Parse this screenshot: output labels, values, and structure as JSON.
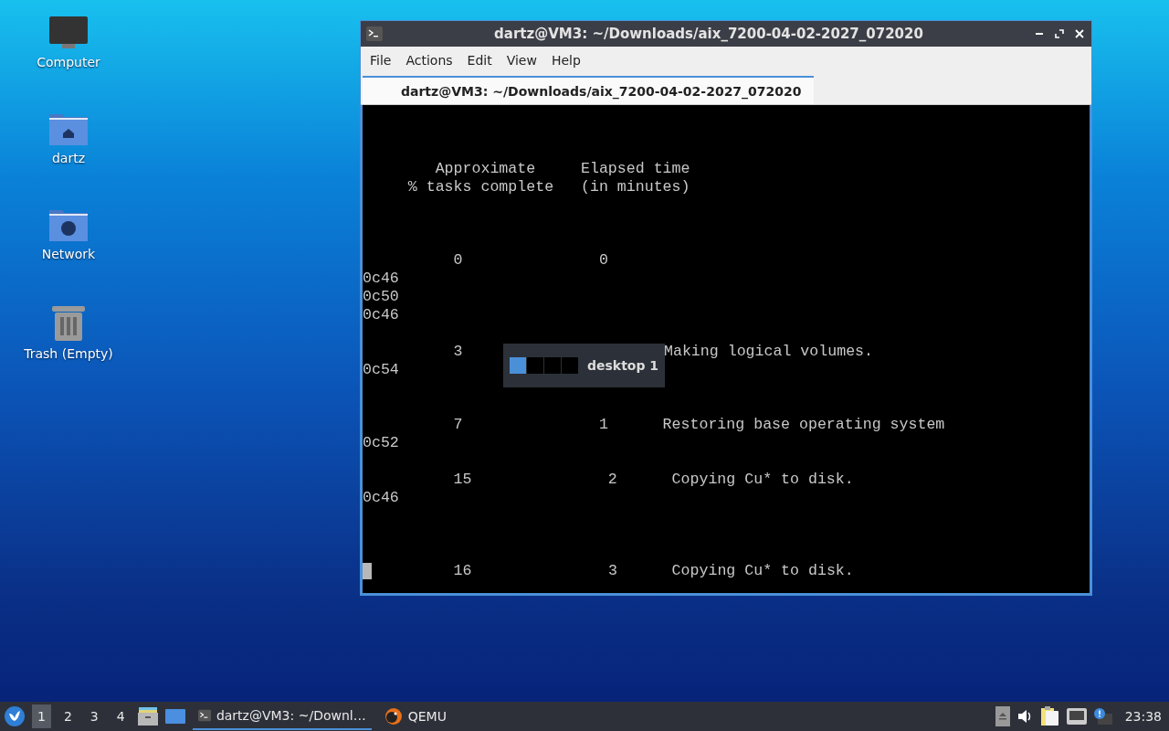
{
  "desktop_icons": [
    {
      "label": "Computer",
      "kind": "computer"
    },
    {
      "label": "dartz",
      "kind": "home"
    },
    {
      "label": "Network",
      "kind": "network"
    },
    {
      "label": "Trash (Empty)",
      "kind": "trash"
    }
  ],
  "window": {
    "title": "dartz@VM3: ~/Downloads/aix_7200-04-02-2027_072020",
    "menu": [
      "File",
      "Actions",
      "Edit",
      "View",
      "Help"
    ],
    "tabs": [
      {
        "label": "dartz@VM3: ~/Downloads/aix_7200-04-02-2027_072020",
        "selected": true
      }
    ],
    "terminal": {
      "lines": [
        {
          "cursor": false
        },
        {
          "cursor": false
        },
        {
          "cursor": false
        },
        {
          "text": "        Approximate     Elapsed time",
          "cursor": false
        },
        {
          "text": "     % tasks complete   (in minutes)",
          "cursor": false
        },
        {
          "cursor": false
        },
        {
          "cursor": false
        },
        {
          "cursor": false
        },
        {
          "text": "          0               0",
          "cursor": false
        },
        {
          "text": "0c46",
          "cursor": false
        },
        {
          "text": "0c50",
          "cursor": false
        },
        {
          "text": "0c46",
          "cursor": false
        },
        {
          "cursor": false
        },
        {
          "text": "          3",
          "text_2": "Making logical volumes.",
          "cursor": false
        },
        {
          "text": "0c54",
          "cursor": false
        },
        {
          "cursor": false
        },
        {
          "cursor": false
        },
        {
          "text": "          7               1      Restoring base operating system",
          "cursor": false
        },
        {
          "text": "0c52",
          "cursor": false
        },
        {
          "cursor": false
        },
        {
          "text": "          15               2      Copying Cu* to disk.",
          "cursor": false
        },
        {
          "text": "0c46",
          "cursor": false
        },
        {
          "cursor": false
        },
        {
          "cursor": false
        },
        {
          "cursor": false
        },
        {
          "text": "          16               3      Copying Cu* to disk.",
          "cursor": true
        }
      ]
    }
  },
  "workspace_popup": {
    "label": "desktop 1",
    "workspaces": [
      {
        "selected": true
      },
      {
        "selected": false
      },
      {
        "selected": false
      },
      {
        "selected": false
      }
    ]
  },
  "taskbar": {
    "workspaces": [
      {
        "label": "1",
        "selected": true
      },
      {
        "label": "2",
        "selected": false
      },
      {
        "label": "3",
        "selected": false
      },
      {
        "label": "4",
        "selected": false
      }
    ],
    "tasks": [
      {
        "label": "dartz@VM3: ~/Downl…",
        "kind": "terminal",
        "selected": true
      },
      {
        "label": "QEMU",
        "kind": "qemu",
        "selected": false
      }
    ],
    "clock": "23:38"
  }
}
